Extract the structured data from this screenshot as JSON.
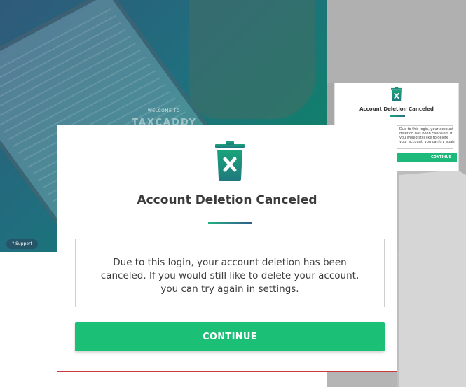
{
  "background": {
    "welcome_text": "WELCOME TO",
    "brand_text": "TAXCADDY",
    "support_label": "Support"
  },
  "preview": {
    "title": "Account Deletion Canceled",
    "message": "Due to this login, your account deletion has been canceled. If you would still like to delete your account, you can try again in settings.",
    "button_label": "CONTINUE"
  },
  "modal": {
    "title": "Account Deletion Canceled",
    "message": "Due to this login, your account deletion has been canceled. If you would still like to delete your account, you can try again in settings.",
    "continue_label": "CONTINUE"
  },
  "colors": {
    "accent_green": "#1cbf76",
    "icon_gradient_top": "#1aa37a",
    "icon_gradient_bottom": "#1f7a7e",
    "highlight_border": "#c63b3b"
  },
  "icons": {
    "modal_icon": "trash-x-icon"
  }
}
